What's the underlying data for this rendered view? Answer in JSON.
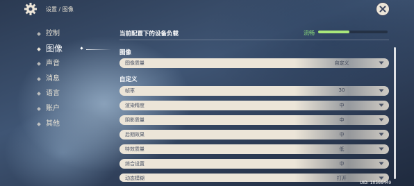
{
  "header": {
    "breadcrumb": "设置 / 图像"
  },
  "sidebar": {
    "items": [
      {
        "label": "控制"
      },
      {
        "label": "图像"
      },
      {
        "label": "声音"
      },
      {
        "label": "消息"
      },
      {
        "label": "语言"
      },
      {
        "label": "账户"
      },
      {
        "label": "其他"
      }
    ],
    "active": "图像"
  },
  "load": {
    "title": "当前配置下的设备负载",
    "status": "流畅",
    "level": 0.45
  },
  "sections": {
    "image": "图像",
    "custom": "自定义"
  },
  "rows": {
    "quality": {
      "label": "图像质量",
      "value": "自定义"
    },
    "custom": [
      {
        "label": "帧率",
        "value": "30"
      },
      {
        "label": "渲染精度",
        "value": "中"
      },
      {
        "label": "阴影质量",
        "value": "中"
      },
      {
        "label": "后期效果",
        "value": "中"
      },
      {
        "label": "特效质量",
        "value": "低"
      },
      {
        "label": "综合设置",
        "value": "中"
      },
      {
        "label": "动态模糊",
        "value": "打开"
      }
    ]
  },
  "uid": "UID: 10566449",
  "colors": {
    "accent_green": "#a9e87a",
    "row_bg": "#ece5d8",
    "row_text": "#4a5366"
  }
}
